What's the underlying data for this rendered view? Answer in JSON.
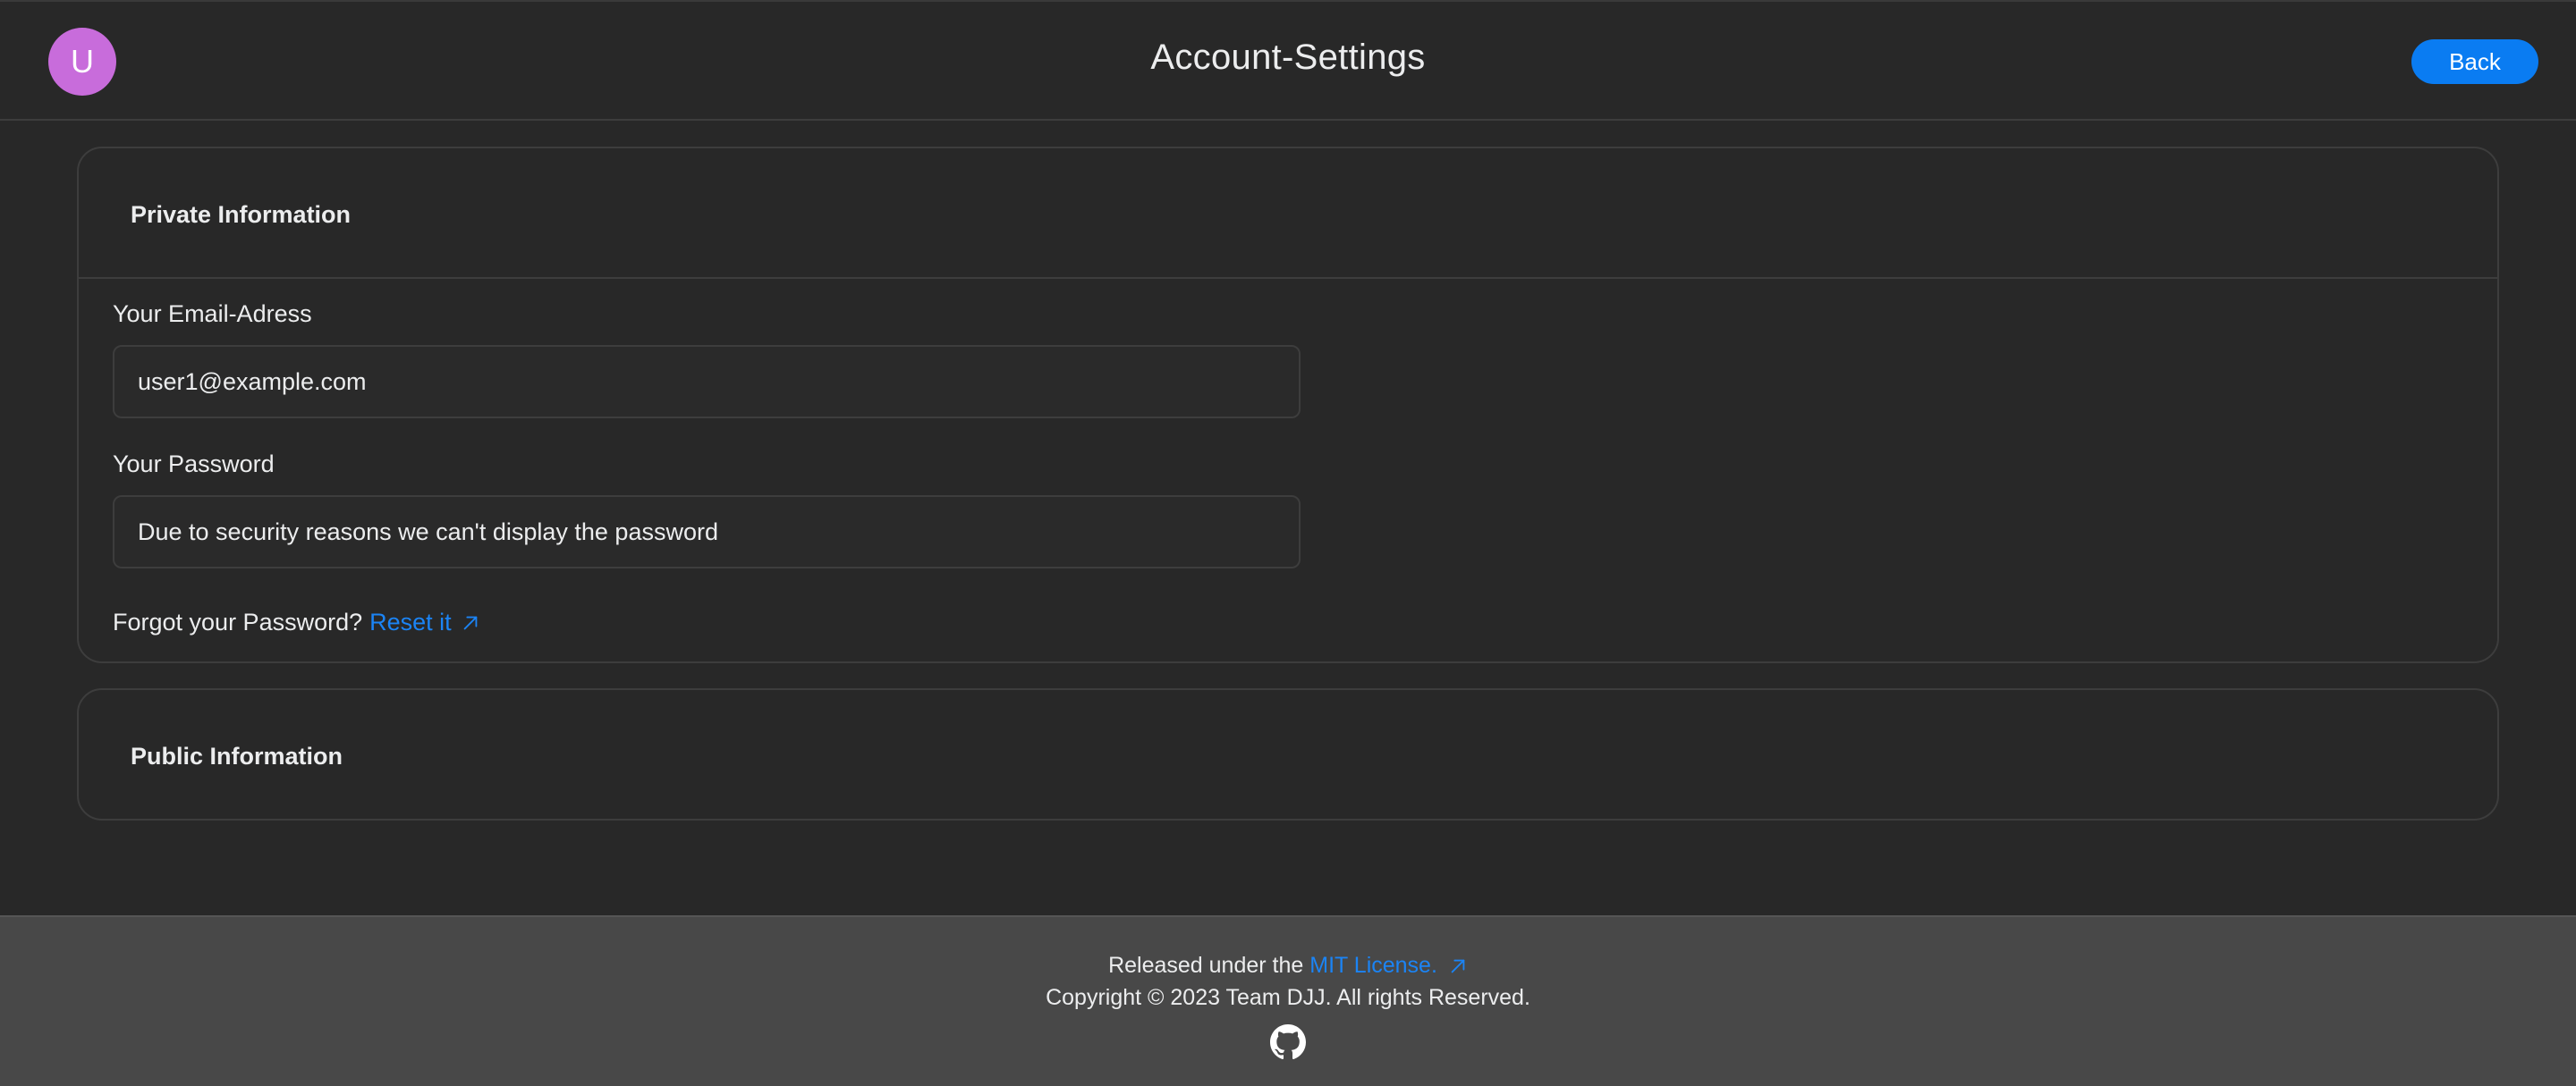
{
  "header": {
    "avatar_initial": "U",
    "title": "Account-Settings",
    "back_label": "Back"
  },
  "private_card": {
    "title": "Private Information",
    "email_label": "Your Email-Adress",
    "email_value": "user1@example.com",
    "password_label": "Your Password",
    "password_value": "Due to security reasons we can't display the password",
    "forgot_text": "Forgot your Password?",
    "reset_link": "Reset it"
  },
  "public_card": {
    "title": "Public Information"
  },
  "footer": {
    "released_text": "Released under the",
    "license_link": "MIT License.",
    "copyright": "Copyright © 2023 Team DJJ. All rights Reserved."
  },
  "icons": {
    "external_link": "arrow-up-right-icon",
    "github": "github-icon"
  },
  "colors": {
    "background": "#282828",
    "accent": "#0a7cf2",
    "link": "#1b84f5",
    "avatar": "#c86cdb",
    "footer": "#484848"
  }
}
